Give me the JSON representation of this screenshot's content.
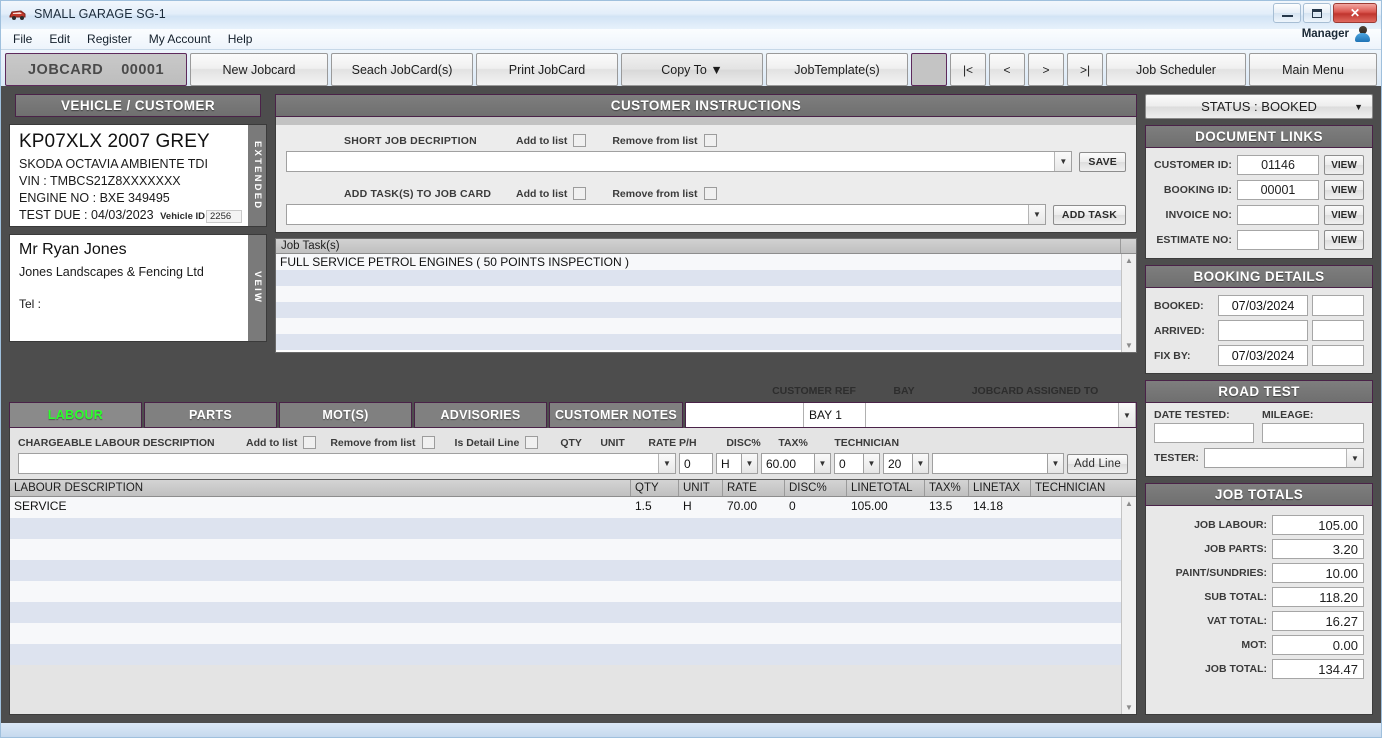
{
  "window": {
    "title": "SMALL GARAGE SG-1",
    "app_icon": "car-icon",
    "minimize": "minimize-icon",
    "maximize": "maximize-icon",
    "close": "✕"
  },
  "menu": {
    "items": [
      "File",
      "Edit",
      "Register",
      "My Account",
      "Help"
    ],
    "user_label": "Manager",
    "user_icon": "user-avatar-icon"
  },
  "toolbar": {
    "jobcard_label": "JOBCARD",
    "jobcard_number": "00001",
    "buttons": [
      "New Jobcard",
      "Seach JobCard(s)",
      "Print JobCard",
      "Copy To ▼",
      "JobTemplate(s)"
    ],
    "nav": [
      "|<",
      "<",
      ">",
      ">|"
    ],
    "right_buttons": [
      "Job Scheduler",
      "Main Menu"
    ]
  },
  "vehicle": {
    "panel_title": "VEHICLE / CUSTOMER",
    "registration": "KP07XLX 2007 GREY",
    "model": "SKODA OCTAVIA AMBIENTE TDI",
    "vin": "VIN : TMBCS21Z8XXXXXXX",
    "engine": "ENGINE NO : BXE 349495",
    "test_due": "TEST DUE : 04/03/2023",
    "vehicle_id_label": "Vehicle ID",
    "vehicle_id_value": "2256",
    "strip_extended": "EXTENDED"
  },
  "customer": {
    "name": "Mr Ryan Jones",
    "company": "Jones Landscapes & Fencing Ltd",
    "tel": "Tel :",
    "strip_view": "VEIW"
  },
  "instructions": {
    "panel_title": "CUSTOMER INSTRUCTIONS",
    "short_job_label": "SHORT JOB DECRIPTION",
    "short_job_value": "",
    "add_task_label": "ADD TASK(S) TO JOB CARD",
    "add_task_value": "",
    "add_to_list": "Add to list",
    "remove_from_list": "Remove from list",
    "save_button": "SAVE",
    "add_task_button": "ADD TASK"
  },
  "tasks": {
    "header": "Job Task(s)",
    "rows": [
      "FULL SERVICE PETROL ENGINES ( 50 POINTS INSPECTION )",
      "",
      "",
      "",
      "",
      ""
    ]
  },
  "tabs": {
    "items": [
      "LABOUR",
      "PARTS",
      "MOT(S)",
      "ADVISORIES",
      "CUSTOMER NOTES"
    ],
    "active": "LABOUR",
    "active_color": "#2bff2b"
  },
  "refs": {
    "customer_ref_label": "CUSTOMER REF",
    "customer_ref_value": "",
    "bay_label": "BAY",
    "bay_value": "BAY 1",
    "assigned_label": "JOBCARD ASSIGNED TO",
    "assigned_value": ""
  },
  "labour_entry": {
    "description_label": "CHARGEABLE LABOUR DESCRIPTION",
    "description_value": "",
    "add_to_list": "Add to list",
    "remove_from_list": "Remove from list",
    "is_detail_line": "Is Detail Line",
    "qty_label": "QTY",
    "qty_value": "0",
    "unit_label": "UNIT",
    "unit_value": "H",
    "rate_label": "RATE P/H",
    "rate_value": "60.00",
    "disc_label": "DISC%",
    "disc_value": "0",
    "tax_label": "TAX%",
    "tax_value": "20",
    "technician_label": "TECHNICIAN",
    "technician_value": "",
    "add_line_button": "Add Line"
  },
  "labour_table": {
    "columns": [
      "LABOUR DESCRIPTION",
      "QTY",
      "UNIT",
      "RATE",
      "DISC%",
      "LINETOTAL",
      "TAX%",
      "LINETAX",
      "TECHNICIAN"
    ],
    "rows": [
      {
        "desc": "SERVICE",
        "qty": "1.5",
        "unit": "H",
        "rate": "70.00",
        "disc": "0",
        "linetotal": "105.00",
        "tax": "13.5",
        "linetax": "14.18",
        "tech": ""
      },
      {
        "desc": "",
        "qty": "",
        "unit": "",
        "rate": "",
        "disc": "",
        "linetotal": "",
        "tax": "",
        "linetax": "",
        "tech": ""
      },
      {
        "desc": "",
        "qty": "",
        "unit": "",
        "rate": "",
        "disc": "",
        "linetotal": "",
        "tax": "",
        "linetax": "",
        "tech": ""
      },
      {
        "desc": "",
        "qty": "",
        "unit": "",
        "rate": "",
        "disc": "",
        "linetotal": "",
        "tax": "",
        "linetax": "",
        "tech": ""
      },
      {
        "desc": "",
        "qty": "",
        "unit": "",
        "rate": "",
        "disc": "",
        "linetotal": "",
        "tax": "",
        "linetax": "",
        "tech": ""
      },
      {
        "desc": "",
        "qty": "",
        "unit": "",
        "rate": "",
        "disc": "",
        "linetotal": "",
        "tax": "",
        "linetax": "",
        "tech": ""
      },
      {
        "desc": "",
        "qty": "",
        "unit": "",
        "rate": "",
        "disc": "",
        "linetotal": "",
        "tax": "",
        "linetax": "",
        "tech": ""
      },
      {
        "desc": "",
        "qty": "",
        "unit": "",
        "rate": "",
        "disc": "",
        "linetotal": "",
        "tax": "",
        "linetax": "",
        "tech": ""
      }
    ]
  },
  "status": {
    "text": "STATUS : BOOKED"
  },
  "document_links": {
    "title": "DOCUMENT LINKS",
    "view_label": "VIEW",
    "rows": [
      {
        "label": "CUSTOMER ID:",
        "value": "01146"
      },
      {
        "label": "BOOKING ID:",
        "value": "00001"
      },
      {
        "label": "INVOICE NO:",
        "value": ""
      },
      {
        "label": "ESTIMATE NO:",
        "value": ""
      }
    ]
  },
  "booking_details": {
    "title": "BOOKING DETAILS",
    "rows": [
      {
        "label": "BOOKED:",
        "value": "07/03/2024",
        "value2": ""
      },
      {
        "label": "ARRIVED:",
        "value": "",
        "value2": ""
      },
      {
        "label": "FIX BY:",
        "value": "07/03/2024",
        "value2": ""
      }
    ]
  },
  "road_test": {
    "title": "ROAD TEST",
    "date_label": "DATE TESTED:",
    "date_value": "",
    "mileage_label": "MILEAGE:",
    "mileage_value": "",
    "tester_label": "TESTER:",
    "tester_value": ""
  },
  "job_totals": {
    "title": "JOB TOTALS",
    "rows": [
      {
        "label": "JOB LABOUR:",
        "value": "105.00"
      },
      {
        "label": "JOB PARTS:",
        "value": "3.20"
      },
      {
        "label": "PAINT/SUNDRIES:",
        "value": "10.00"
      },
      {
        "label": "SUB TOTAL:",
        "value": "118.20"
      },
      {
        "label": "VAT TOTAL:",
        "value": "16.27"
      },
      {
        "label": "MOT:",
        "value": "0.00"
      },
      {
        "label": "JOB TOTAL:",
        "value": "134.47"
      }
    ]
  }
}
